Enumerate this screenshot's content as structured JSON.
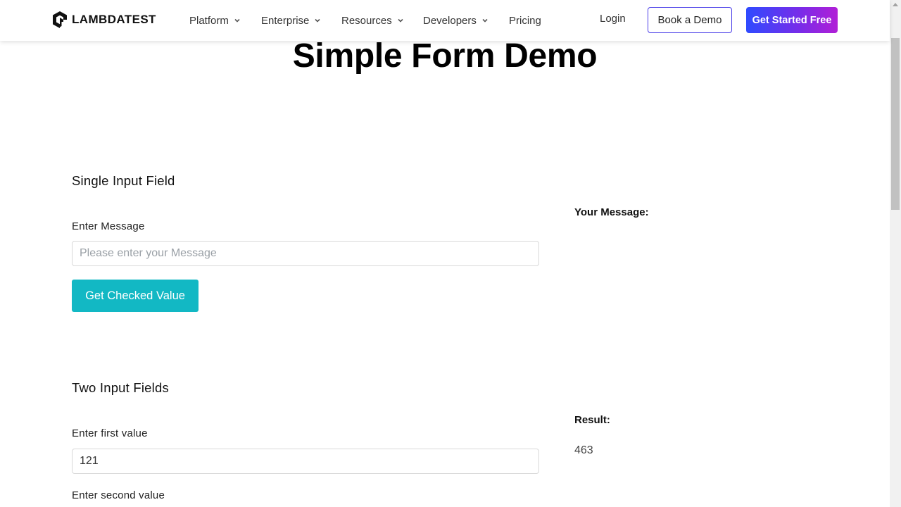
{
  "header": {
    "brand": "LAMBDATEST",
    "nav": [
      {
        "label": "Platform",
        "has_dropdown": true
      },
      {
        "label": "Enterprise",
        "has_dropdown": true
      },
      {
        "label": "Resources",
        "has_dropdown": true
      },
      {
        "label": "Developers",
        "has_dropdown": true
      },
      {
        "label": "Pricing",
        "has_dropdown": false
      }
    ],
    "login_label": "Login",
    "book_demo_label": "Book a Demo",
    "get_started_label": "Get Started Free"
  },
  "page": {
    "title": "Simple Form Demo"
  },
  "single_input": {
    "section_title": "Single Input Field",
    "field_label": "Enter Message",
    "placeholder": "Please enter your Message",
    "value": "",
    "button_label": "Get Checked Value",
    "result_label": "Your Message:",
    "result_value": ""
  },
  "two_inputs": {
    "section_title": "Two Input Fields",
    "first_label": "Enter first value",
    "first_value": "121",
    "second_label": "Enter second value",
    "result_label": "Result:",
    "result_value": "463"
  },
  "colors": {
    "accent_button": "#12b8c4",
    "cta_gradient_start": "#2f4bff",
    "cta_gradient_end": "#b11fd6",
    "demo_border": "#4a3ee8"
  }
}
